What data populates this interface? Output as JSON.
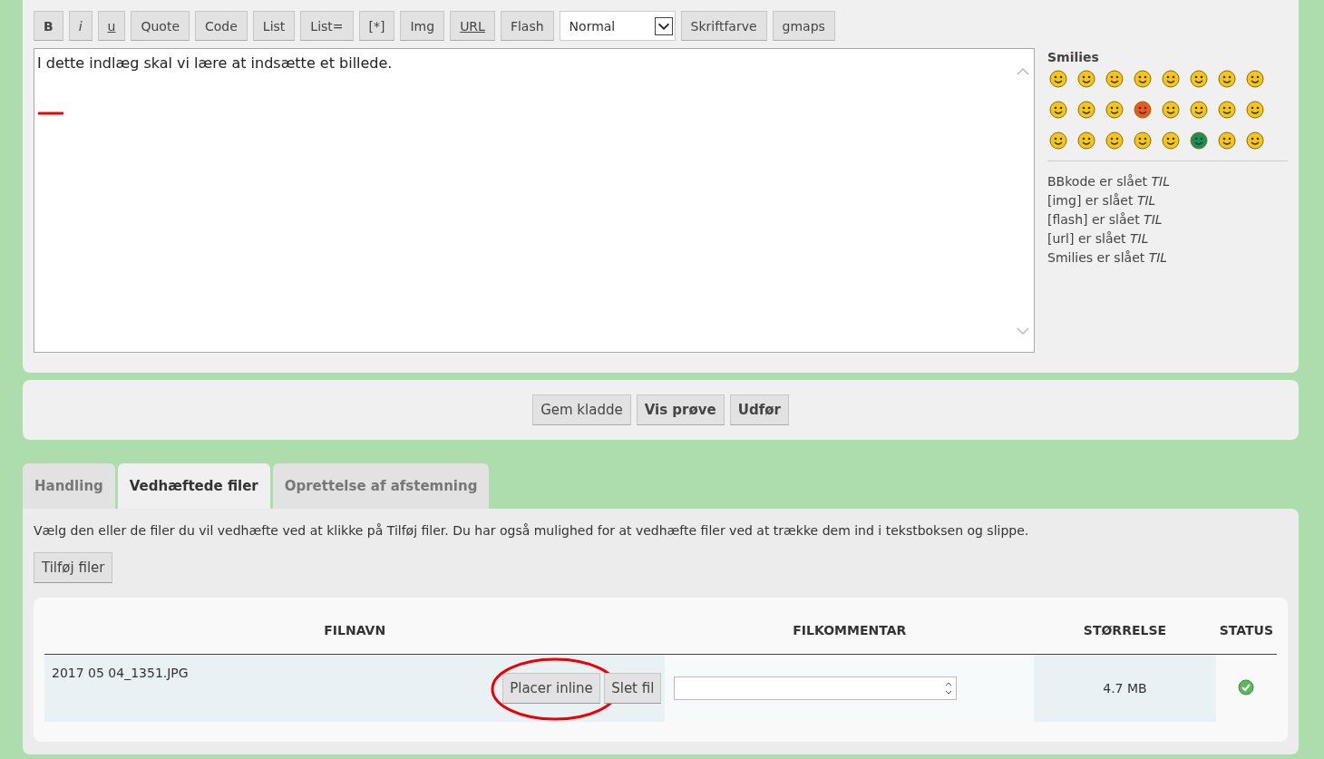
{
  "toolbar": [
    {
      "kind": "bold",
      "label": "B"
    },
    {
      "kind": "italic",
      "label": "i"
    },
    {
      "kind": "underline",
      "label": "u"
    },
    {
      "kind": "plain",
      "label": "Quote"
    },
    {
      "kind": "plain",
      "label": "Code"
    },
    {
      "kind": "plain",
      "label": "List"
    },
    {
      "kind": "plain",
      "label": "List="
    },
    {
      "kind": "plain",
      "label": "[*]"
    },
    {
      "kind": "plain",
      "label": "Img"
    },
    {
      "kind": "underline",
      "label": "URL"
    },
    {
      "kind": "plain",
      "label": "Flash"
    },
    {
      "kind": "select",
      "label": "Normal"
    },
    {
      "kind": "plain",
      "label": "Skriftfarve"
    },
    {
      "kind": "plain",
      "label": "gmaps"
    }
  ],
  "editor": {
    "value": "I dette indlæg skal vi lære at indsætte et billede."
  },
  "smilies": {
    "title": "Smilies",
    "items": [
      {
        "color": "#f5c518"
      },
      {
        "color": "#f5c518"
      },
      {
        "color": "#f5c518"
      },
      {
        "color": "#f5c518"
      },
      {
        "color": "#f5c518"
      },
      {
        "color": "#f5c518"
      },
      {
        "color": "#f5c518"
      },
      {
        "color": "#f5c518"
      },
      {
        "color": "#f5c518"
      },
      {
        "color": "#f5c518"
      },
      {
        "color": "#f5c518"
      },
      {
        "color": "#f0561e"
      },
      {
        "color": "#f5c518"
      },
      {
        "color": "#f5c518"
      },
      {
        "color": "#f5c518"
      },
      {
        "color": "#f5c518"
      },
      {
        "color": "#f5c518"
      },
      {
        "color": "#f5c518"
      },
      {
        "color": "#f5c518"
      },
      {
        "color": "#f5c518"
      },
      {
        "color": "#f5c518"
      },
      {
        "color": "#17915a"
      },
      {
        "color": "#f5c518"
      },
      {
        "color": "#f5c518"
      }
    ]
  },
  "settings": [
    "BBkode er slået *TIL*",
    "[img] er slået *TIL*",
    "[flash] er slået *TIL*",
    "[url] er slået *TIL*",
    "Smilies er slået *TIL*"
  ],
  "actions": [
    {
      "label": "Gem kladde",
      "primary": false
    },
    {
      "label": "Vis prøve",
      "primary": true
    },
    {
      "label": "Udfør",
      "primary": true
    }
  ],
  "tabs": [
    {
      "label": "Handling",
      "selected": false
    },
    {
      "label": "Vedhæftede filer",
      "selected": true
    },
    {
      "label": "Oprettelse af afstemning",
      "selected": false
    }
  ],
  "attachments": {
    "hint": "Vælg den eller de filer du vil vedhæfte ved at klikke på Tilføj filer. Du har også mulighed for at vedhæfte filer ved at trække dem ind i tekstboksen og slippe.",
    "add_button": "Tilføj filer",
    "columns": [
      "FILNAVN",
      "FILKOMMENTAR",
      "STØRRELSE",
      "STATUS"
    ],
    "rows": [
      {
        "filename": "2017 05 04_1351.JPG",
        "buttons": [
          "Placer inline",
          "Slet fil"
        ],
        "size": "4.7 MB"
      }
    ]
  }
}
